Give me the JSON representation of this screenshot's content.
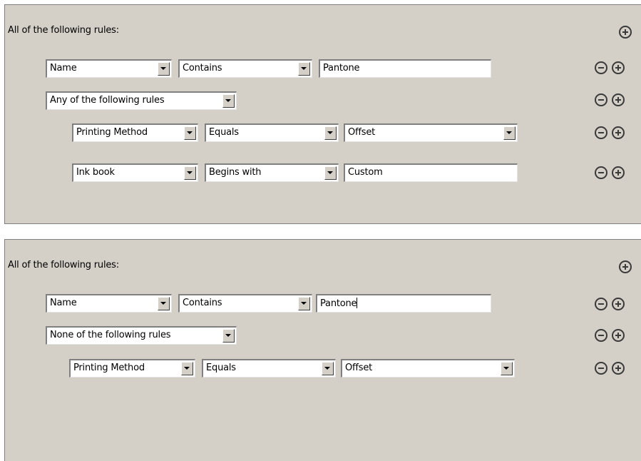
{
  "panel1": {
    "heading": "All of the following rules:",
    "rule1": {
      "field": "Name",
      "operator": "Contains",
      "value": "Pantone"
    },
    "group": {
      "mode": "Any of the following rules"
    },
    "rule2": {
      "field": "Printing Method",
      "operator": "Equals",
      "value": "Offset"
    },
    "rule3": {
      "field": "Ink book",
      "operator": "Begins with",
      "value": "Custom"
    }
  },
  "panel2": {
    "heading": "All of the following rules:",
    "rule1": {
      "field": "Name",
      "operator": "Contains",
      "value": "Pantone"
    },
    "group": {
      "mode": "None of the following rules"
    },
    "rule2": {
      "field": "Printing Method",
      "operator": "Equals",
      "value": "Offset"
    }
  },
  "icons": {
    "add": "plus-circle-icon",
    "remove": "minus-circle-icon",
    "dropdown": "chevron-down-icon"
  }
}
